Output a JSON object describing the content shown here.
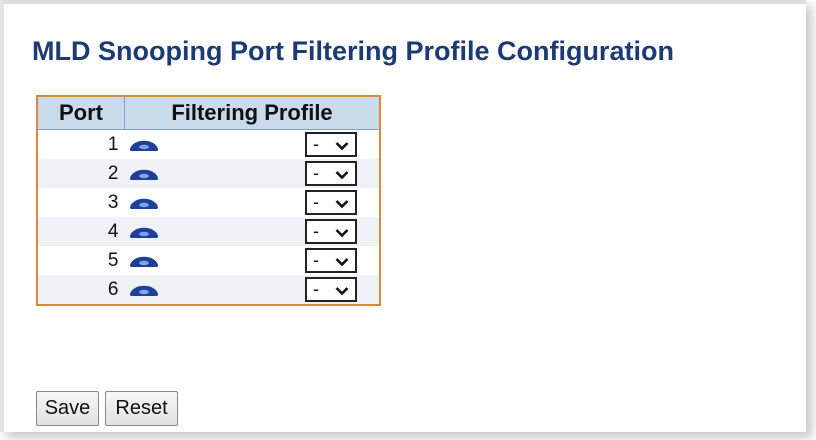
{
  "page_title": "MLD Snooping Port Filtering Profile Configuration",
  "table": {
    "headers": {
      "port": "Port",
      "profile": "Filtering Profile"
    },
    "rows": [
      {
        "port": "1",
        "profile_value": "-"
      },
      {
        "port": "2",
        "profile_value": "-"
      },
      {
        "port": "3",
        "profile_value": "-"
      },
      {
        "port": "4",
        "profile_value": "-"
      },
      {
        "port": "5",
        "profile_value": "-"
      },
      {
        "port": "6",
        "profile_value": "-"
      }
    ]
  },
  "buttons": {
    "save": "Save",
    "reset": "Reset"
  },
  "icons": {
    "row_icon": "eye-icon",
    "dropdown": "chevron-down-icon"
  },
  "colors": {
    "title": "#1c3b74",
    "header_bg": "#c9daea",
    "table_border": "#d88a3c",
    "eye_icon": "#1f3f9b",
    "row_alt": "#eef1f6"
  }
}
